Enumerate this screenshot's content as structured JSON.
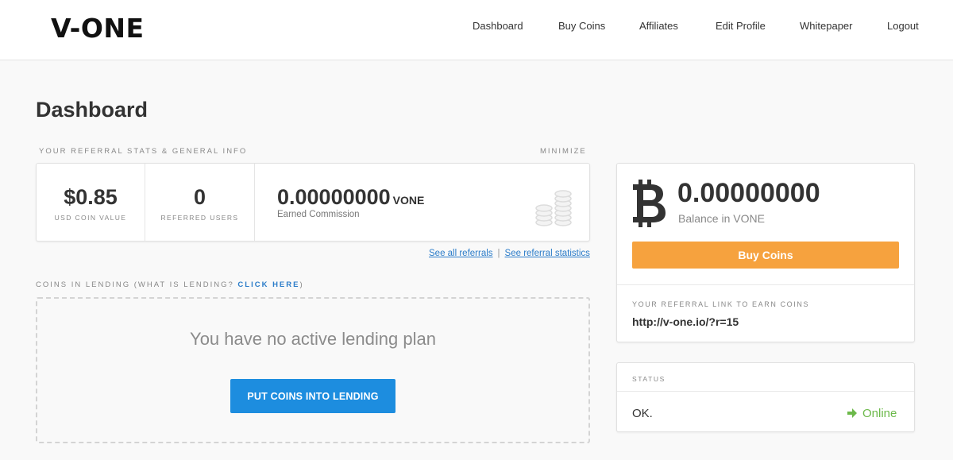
{
  "header": {
    "logo": "V-ONE",
    "nav": [
      "Dashboard",
      "Buy Coins",
      "Affiliates",
      "Edit Profile",
      "Whitepaper",
      "Logout"
    ]
  },
  "page": {
    "title": "Dashboard",
    "referral_section_label": "YOUR REFERRAL STATS & GENERAL INFO",
    "minimize_label": "MINIMIZE"
  },
  "stats": {
    "coin_value": "$0.85",
    "coin_value_label": "USD COIN VALUE",
    "referred_users": "0",
    "referred_users_label": "REFERRED USERS",
    "commission_value": "0.00000000",
    "commission_unit": "VONE",
    "commission_label": "Earned Commission"
  },
  "referral_links": {
    "see_all": "See all referrals",
    "separator": "|",
    "statistics": "See referral statistics"
  },
  "lending": {
    "label_prefix": "COINS IN LENDING (WHAT IS LENDING?",
    "label_link": "CLICK HERE",
    "label_suffix": ")",
    "message": "You have no active lending plan",
    "button": "PUT COINS INTO LENDING"
  },
  "balance": {
    "amount": "0.00000000",
    "label": "Balance in VONE",
    "buy_button": "Buy Coins",
    "referral_link_label": "YOUR REFERRAL LINK TO EARN COINS",
    "referral_link": "http://v-one.io/?r=15"
  },
  "status": {
    "label": "STATUS",
    "text": "OK.",
    "online": "Online",
    "online_color": "#6cb94a"
  },
  "colors": {
    "accent_blue": "#1d8ddf",
    "link_blue": "#2b7cc9",
    "buy_orange": "#f6a23e"
  },
  "icons": [
    "bitcoin-icon",
    "coin-stack-icon",
    "arrow-right-icon"
  ]
}
